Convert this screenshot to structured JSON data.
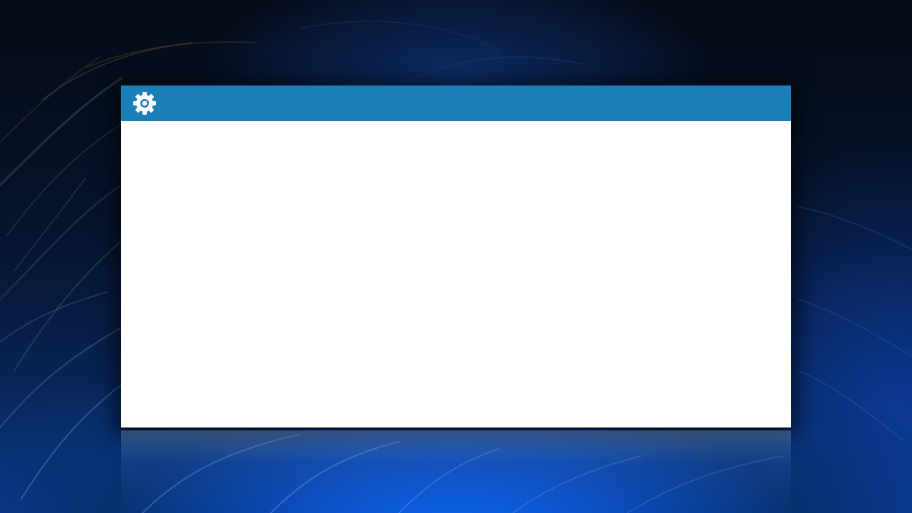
{
  "desktop": {
    "wallpaper": "blue-grass-wallpaper",
    "accent": "#0b6cff"
  },
  "dialog": {
    "title": "",
    "header_color": "#1a7fb5",
    "body_color": "#ffffff",
    "icon": "gear-icon"
  }
}
